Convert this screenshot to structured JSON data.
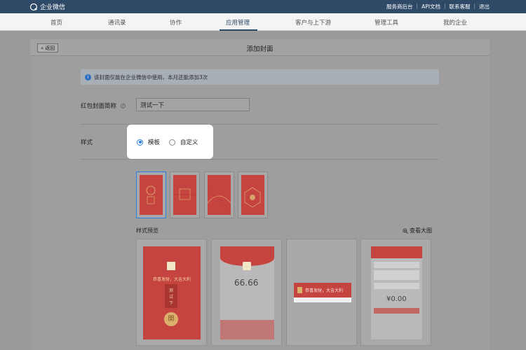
{
  "app": {
    "name": "企业微信"
  },
  "top_links": [
    "服务商后台",
    "API文档",
    "联系客服",
    "退出"
  ],
  "nav": {
    "items": [
      {
        "label": "首页"
      },
      {
        "label": "通讯录"
      },
      {
        "label": "协作"
      },
      {
        "label": "应用管理"
      },
      {
        "label": "客户与上下游"
      },
      {
        "label": "管理工具"
      },
      {
        "label": "我的企业"
      }
    ],
    "active": "应用管理"
  },
  "page": {
    "back_label": "返回",
    "title": "添加封面",
    "notice": "该封面仅能在企业微信中使用，本月还能添加3次",
    "name_label": "红包封面简称",
    "name_value": "测试一下",
    "style_label": "样式",
    "radio_template": "模板",
    "radio_custom": "自定义",
    "selected_style": "模板",
    "preview_label": "样式预览",
    "big_view_label": "查看大图"
  },
  "preview": {
    "greeting": "恭喜发财，大吉大利",
    "amount": "66.66",
    "amount2": "¥0.00",
    "p1_line1": "测",
    "p1_line2": "试",
    "p1_line3": "下",
    "p1_open": "開"
  },
  "colors": {
    "topbar": "#2f4a67",
    "accent": "#2a7de1",
    "cover_red": "#c6443f"
  }
}
